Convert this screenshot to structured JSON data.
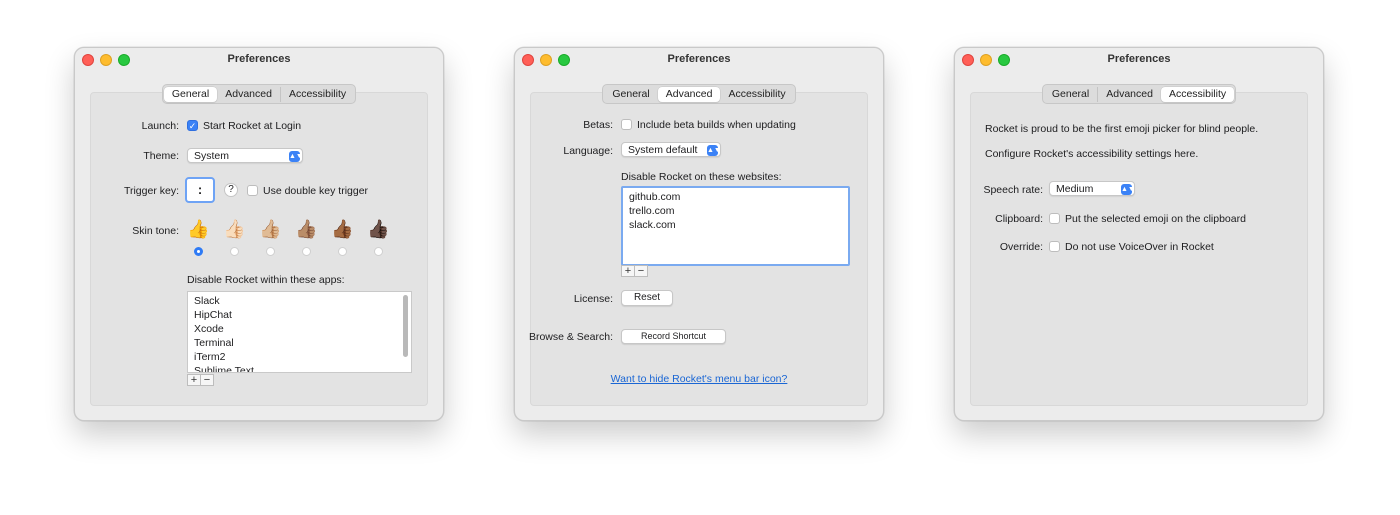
{
  "windows": [
    {
      "title": "Preferences",
      "tabs": [
        "General",
        "Advanced",
        "Accessibility"
      ],
      "active_tab": "General",
      "launch": {
        "label": "Launch:",
        "checkbox_label": "Start Rocket at Login",
        "checked": true
      },
      "theme": {
        "label": "Theme:",
        "value": "System"
      },
      "trigger_key": {
        "label": "Trigger key:",
        "value": ":",
        "help": "?",
        "checkbox_label": "Use double key trigger",
        "checked": false
      },
      "skin_tone": {
        "label": "Skin tone:",
        "selected_index": 0,
        "tones": [
          "👍",
          "👍🏻",
          "👍🏼",
          "👍🏽",
          "👍🏾",
          "👍🏿"
        ]
      },
      "apps": {
        "heading": "Disable Rocket within these apps:",
        "items": [
          "Slack",
          "HipChat",
          "Xcode",
          "Terminal",
          "iTerm2",
          "Sublime Text"
        ]
      },
      "plus": "+",
      "minus": "−"
    },
    {
      "title": "Preferences",
      "tabs": [
        "General",
        "Advanced",
        "Accessibility"
      ],
      "active_tab": "Advanced",
      "betas": {
        "label": "Betas:",
        "checkbox_label": "Include beta builds when updating",
        "checked": false
      },
      "language": {
        "label": "Language:",
        "value": "System default"
      },
      "websites": {
        "heading": "Disable Rocket on these websites:",
        "items": [
          "github.com",
          "trello.com",
          "slack.com"
        ]
      },
      "plus": "+",
      "minus": "−",
      "license": {
        "label": "License:",
        "button": "Reset"
      },
      "browse": {
        "label": "Browse & Search:",
        "button": "Record Shortcut"
      },
      "link": "Want to hide Rocket's menu bar icon?"
    },
    {
      "title": "Preferences",
      "tabs": [
        "General",
        "Advanced",
        "Accessibility"
      ],
      "active_tab": "Accessibility",
      "intro1": "Rocket is proud to be the first emoji picker for blind people.",
      "intro2": "Configure Rocket's accessibility settings here.",
      "speech_rate": {
        "label": "Speech rate:",
        "value": "Medium"
      },
      "clipboard": {
        "label": "Clipboard:",
        "checkbox_label": "Put the selected emoji on the clipboard",
        "checked": false
      },
      "override": {
        "label": "Override:",
        "checkbox_label": "Do not use VoiceOver in Rocket",
        "checked": false
      }
    }
  ]
}
